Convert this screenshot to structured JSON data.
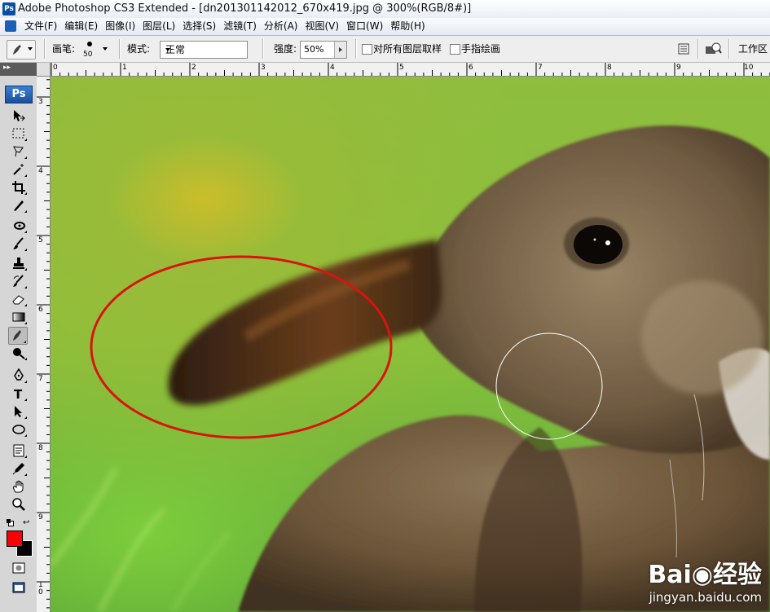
{
  "window": {
    "title": "Adobe Photoshop CS3 Extended - [dn201301142012_670x419.jpg @ 300%(RGB/8#)]",
    "app_badge": "Ps"
  },
  "menu": {
    "items": [
      "文件(F)",
      "编辑(E)",
      "图像(I)",
      "图层(L)",
      "选择(S)",
      "滤镜(T)",
      "分析(A)",
      "视图(V)",
      "窗口(W)",
      "帮助(H)"
    ]
  },
  "options": {
    "brush_label": "画笔:",
    "brush_size": "50",
    "mode_label": "模式:",
    "mode_value": "正常",
    "strength_label": "强度:",
    "strength_value": "50%",
    "sample_all_layers": "对所有图层取样",
    "finger_painting": "手指绘画",
    "workspace": "工作区"
  },
  "toolbox": {
    "ps_logo": "Ps",
    "collapse_glyph": "▸▸",
    "foreground_color": "#ff0000",
    "background_color": "#000000",
    "active_tool": "smudge-tool"
  },
  "rulers": {
    "horizontal": [
      "0",
      "1",
      "2",
      "3",
      "4",
      "5",
      "6",
      "7",
      "8",
      "9",
      "10"
    ],
    "vertical": [
      "3",
      "4",
      "5",
      "6",
      "7",
      "8",
      "9",
      "1\n0"
    ]
  },
  "canvas": {
    "image": "rabbit with ear highlighted by red ellipse",
    "annotation_color": "#d8140f"
  },
  "watermark": {
    "brand": "Bai◉经验",
    "url": "jingyan.baidu.com"
  }
}
